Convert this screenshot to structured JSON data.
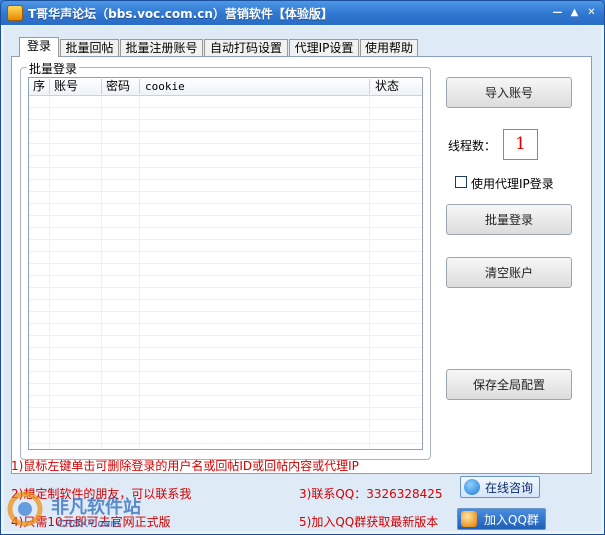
{
  "window": {
    "title": "T哥华声论坛（bbs.voc.com.cn）营销软件【体验版】",
    "controls": [
      "—",
      "▲",
      "✕"
    ]
  },
  "tabs": [
    {
      "label": "登录",
      "active": true
    },
    {
      "label": "批量回帖",
      "active": false
    },
    {
      "label": "批量注册账号",
      "active": false
    },
    {
      "label": "自动打码设置",
      "active": false
    },
    {
      "label": "代理IP设置",
      "active": false
    },
    {
      "label": "使用帮助",
      "active": false
    }
  ],
  "login_panel": {
    "group_title": "批量登录",
    "columns": [
      "序",
      "账号",
      "密码",
      "cookie",
      "状态"
    ],
    "rows": []
  },
  "side": {
    "import_button": "导入账号",
    "thread_label": "线程数：",
    "thread_value": "1",
    "proxy_checkbox_label": "使用代理IP登录",
    "proxy_checked": false,
    "batch_login_button": "批量登录",
    "clear_button": "清空账户",
    "save_button": "保存全局配置"
  },
  "footer": {
    "tip1": "1)鼠标左键单击可删除登录的用户名或回帖ID或回帖内容或代理IP",
    "tip2": "2)想定制软件的朋友，可以联系我",
    "tip3": "3)联系QQ：3326328425",
    "tip4": "4)只需10元即可去官网正式版",
    "tip5": "5)加入QQ群获取最新版本",
    "online_button": "在线咨询",
    "qq_group_button": "加入QQ群"
  },
  "watermark": {
    "text_cn": "非凡软件站",
    "text_en": "CRSKY.com"
  },
  "colors": {
    "title_bar": "#2f76d0",
    "tip_text": "#d40000",
    "thread_value": "#e00000"
  }
}
